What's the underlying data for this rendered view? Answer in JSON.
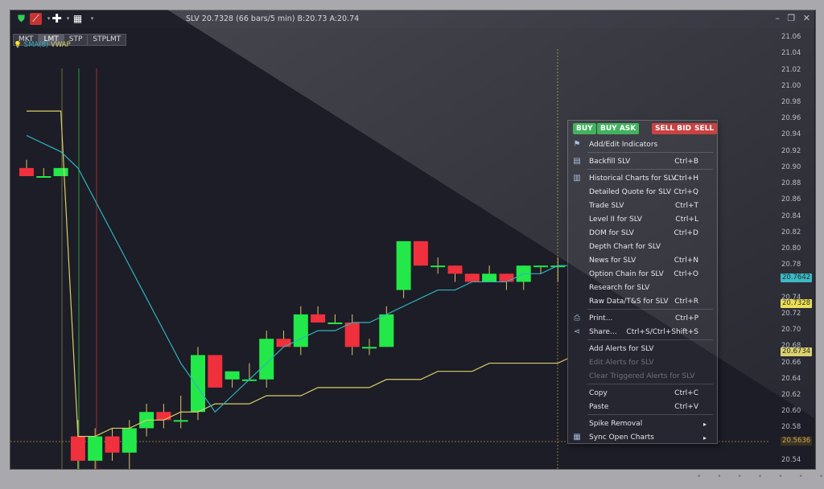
{
  "window": {
    "title": "SLV 20.7328 (66 bars/5 min) B:20.73 A:20.74",
    "minimize_glyph": "–",
    "restore_glyph": "❐",
    "close_glyph": "✕"
  },
  "toolbar": {
    "icons": [
      "shield-icon",
      "chart-style-icon",
      "crosshair-icon",
      "chart-window-icon",
      "dropdown-icon"
    ],
    "dropdown_glyph": "▾"
  },
  "order_tabs": [
    "MKT",
    "LMT",
    "STP",
    "STPLMT"
  ],
  "active_order_tab": "LMT",
  "indicators": {
    "sma_label": "SMA(8)",
    "vwap_label": "VWAP",
    "sma_color": "#2fb3c0",
    "vwap_color": "#d9cf67"
  },
  "y_axis": {
    "ticks": [
      "21.06",
      "21.04",
      "21.02",
      "21.00",
      "20.98",
      "20.96",
      "20.94",
      "20.92",
      "20.90",
      "20.88",
      "20.86",
      "20.84",
      "20.82",
      "20.80",
      "20.78",
      "20.76",
      "20.74",
      "20.72",
      "20.70",
      "20.68",
      "20.66",
      "20.64",
      "20.62",
      "20.60",
      "20.58",
      "20.56",
      "20.54"
    ],
    "price_labels": [
      {
        "value": "20.7642",
        "color": "#2fb3c0",
        "text_color": "#0e1b1d"
      },
      {
        "value": "20.7328",
        "color": "#e9dc4a",
        "text_color": "#1c1c10"
      },
      {
        "value": "20.6734",
        "color": "#d9cf67",
        "text_color": "#1c1c10"
      },
      {
        "value": "20.5636",
        "color": "#3b3320",
        "text_color": "#c8a35a"
      }
    ]
  },
  "chart_data": {
    "type": "candlestick",
    "symbol": "SLV",
    "interval": "5 min",
    "ylim": [
      20.53,
      21.07
    ],
    "up_color": "#22e84a",
    "down_color": "#f0303c",
    "candles": [
      {
        "o": 20.9,
        "h": 20.91,
        "l": 20.89,
        "c": 20.89
      },
      {
        "o": 20.89,
        "h": 20.9,
        "l": 20.89,
        "c": 20.89
      },
      {
        "o": 20.89,
        "h": 20.9,
        "l": 20.89,
        "c": 20.9
      },
      {
        "o": 20.57,
        "h": 20.59,
        "l": 20.53,
        "c": 20.54
      },
      {
        "o": 20.54,
        "h": 20.58,
        "l": 20.53,
        "c": 20.57
      },
      {
        "o": 20.57,
        "h": 20.58,
        "l": 20.54,
        "c": 20.55
      },
      {
        "o": 20.55,
        "h": 20.59,
        "l": 20.53,
        "c": 20.58
      },
      {
        "o": 20.58,
        "h": 20.61,
        "l": 20.57,
        "c": 20.6
      },
      {
        "o": 20.6,
        "h": 20.61,
        "l": 20.58,
        "c": 20.59
      },
      {
        "o": 20.59,
        "h": 20.62,
        "l": 20.58,
        "c": 20.59
      },
      {
        "o": 20.6,
        "h": 20.68,
        "l": 20.59,
        "c": 20.67
      },
      {
        "o": 20.67,
        "h": 20.67,
        "l": 20.63,
        "c": 20.63
      },
      {
        "o": 20.64,
        "h": 20.65,
        "l": 20.63,
        "c": 20.65
      },
      {
        "o": 20.64,
        "h": 20.66,
        "l": 20.64,
        "c": 20.64
      },
      {
        "o": 20.64,
        "h": 20.7,
        "l": 20.63,
        "c": 20.69
      },
      {
        "o": 20.69,
        "h": 20.7,
        "l": 20.68,
        "c": 20.68
      },
      {
        "o": 20.68,
        "h": 20.73,
        "l": 20.67,
        "c": 20.72
      },
      {
        "o": 20.72,
        "h": 20.73,
        "l": 20.71,
        "c": 20.71
      },
      {
        "o": 20.71,
        "h": 20.72,
        "l": 20.71,
        "c": 20.71
      },
      {
        "o": 20.71,
        "h": 20.72,
        "l": 20.67,
        "c": 20.68
      },
      {
        "o": 20.68,
        "h": 20.69,
        "l": 20.67,
        "c": 20.68
      },
      {
        "o": 20.68,
        "h": 20.73,
        "l": 20.68,
        "c": 20.72
      },
      {
        "o": 20.75,
        "h": 20.81,
        "l": 20.74,
        "c": 20.81
      },
      {
        "o": 20.81,
        "h": 20.81,
        "l": 20.78,
        "c": 20.78
      },
      {
        "o": 20.78,
        "h": 20.79,
        "l": 20.77,
        "c": 20.78
      },
      {
        "o": 20.78,
        "h": 20.78,
        "l": 20.76,
        "c": 20.77
      },
      {
        "o": 20.77,
        "h": 20.77,
        "l": 20.76,
        "c": 20.76
      },
      {
        "o": 20.76,
        "h": 20.78,
        "l": 20.76,
        "c": 20.77
      },
      {
        "o": 20.77,
        "h": 20.77,
        "l": 20.75,
        "c": 20.76
      },
      {
        "o": 20.76,
        "h": 20.78,
        "l": 20.75,
        "c": 20.78
      },
      {
        "o": 20.78,
        "h": 20.78,
        "l": 20.77,
        "c": 20.78
      },
      {
        "o": 20.78,
        "h": 20.79,
        "l": 20.76,
        "c": 20.78
      },
      {
        "o": 20.78,
        "h": 20.8,
        "l": 20.77,
        "c": 20.79
      },
      {
        "o": 20.81,
        "h": 20.82,
        "l": 20.8,
        "c": 20.82
      },
      {
        "o": 20.79,
        "h": 20.79,
        "l": 20.75,
        "c": 20.76
      },
      {
        "o": 20.76,
        "h": 20.76,
        "l": 20.75,
        "c": 20.75
      },
      {
        "o": 20.75,
        "h": 20.75,
        "l": 20.73,
        "c": 20.74
      }
    ],
    "sma": [
      20.94,
      20.93,
      20.92,
      20.9,
      20.86,
      20.82,
      20.78,
      20.74,
      20.7,
      20.66,
      20.63,
      20.6,
      20.62,
      20.64,
      20.66,
      20.68,
      20.69,
      20.7,
      20.7,
      20.71,
      20.71,
      20.72,
      20.73,
      20.74,
      20.75,
      20.75,
      20.76,
      20.76,
      20.76,
      20.77,
      20.77,
      20.78,
      20.78,
      20.79,
      20.78,
      20.77,
      20.76
    ],
    "vwap": [
      20.97,
      20.97,
      20.97,
      20.57,
      20.57,
      20.58,
      20.58,
      20.59,
      20.59,
      20.6,
      20.6,
      20.61,
      20.61,
      20.61,
      20.62,
      20.62,
      20.62,
      20.63,
      20.63,
      20.63,
      20.63,
      20.64,
      20.64,
      20.64,
      20.65,
      20.65,
      20.65,
      20.66,
      20.66,
      20.66,
      20.66,
      20.66,
      20.67,
      20.67,
      20.67,
      20.67,
      20.67
    ],
    "reference_price": 20.5636
  },
  "context_menu": {
    "buttons": [
      {
        "label": "BUY",
        "color": "green"
      },
      {
        "label": "BUY ASK",
        "color": "green"
      },
      {
        "label": "SELL BID",
        "color": "red"
      },
      {
        "label": "SELL",
        "color": "red"
      }
    ],
    "items": [
      {
        "label": "Add/Edit Indicators",
        "shortcut": "",
        "icon": "indicators-icon",
        "sep_after": true
      },
      {
        "label": "Backfill SLV",
        "shortcut": "Ctrl+B",
        "icon": "backfill-icon",
        "sep_after": true
      },
      {
        "label": "Historical Charts for SLV",
        "shortcut": "Ctrl+H",
        "icon": "history-icon"
      },
      {
        "label": "Detailed Quote for SLV",
        "shortcut": "Ctrl+Q"
      },
      {
        "label": "Trade SLV",
        "shortcut": "Ctrl+T"
      },
      {
        "label": "Level II for SLV",
        "shortcut": "Ctrl+L"
      },
      {
        "label": "DOM for SLV",
        "shortcut": "Ctrl+D"
      },
      {
        "label": "Depth Chart for SLV",
        "shortcut": ""
      },
      {
        "label": "News for SLV",
        "shortcut": "Ctrl+N"
      },
      {
        "label": "Option Chain for SLV",
        "shortcut": "Ctrl+O"
      },
      {
        "label": "Research for SLV",
        "shortcut": ""
      },
      {
        "label": "Raw Data/T&S for SLV",
        "shortcut": "Ctrl+R",
        "sep_after": true
      },
      {
        "label": "Print...",
        "shortcut": "Ctrl+P",
        "icon": "print-icon"
      },
      {
        "label": "Share...",
        "shortcut": "Ctrl+S/Ctrl+Shift+S",
        "icon": "share-icon",
        "sep_after": true
      },
      {
        "label": "Add Alerts for SLV",
        "shortcut": ""
      },
      {
        "label": "Edit Alerts for SLV",
        "shortcut": "",
        "disabled": true
      },
      {
        "label": "Clear Triggered Alerts for SLV",
        "shortcut": "",
        "disabled": true,
        "sep_after": true
      },
      {
        "label": "Copy",
        "shortcut": "Ctrl+C"
      },
      {
        "label": "Paste",
        "shortcut": "Ctrl+V",
        "sep_after": true
      },
      {
        "label": "Spike Removal",
        "shortcut": "",
        "submenu": true
      },
      {
        "label": "Sync Open Charts",
        "shortcut": "",
        "submenu": true,
        "icon": "sync-icon"
      }
    ],
    "submenu_glyph": "▸"
  }
}
